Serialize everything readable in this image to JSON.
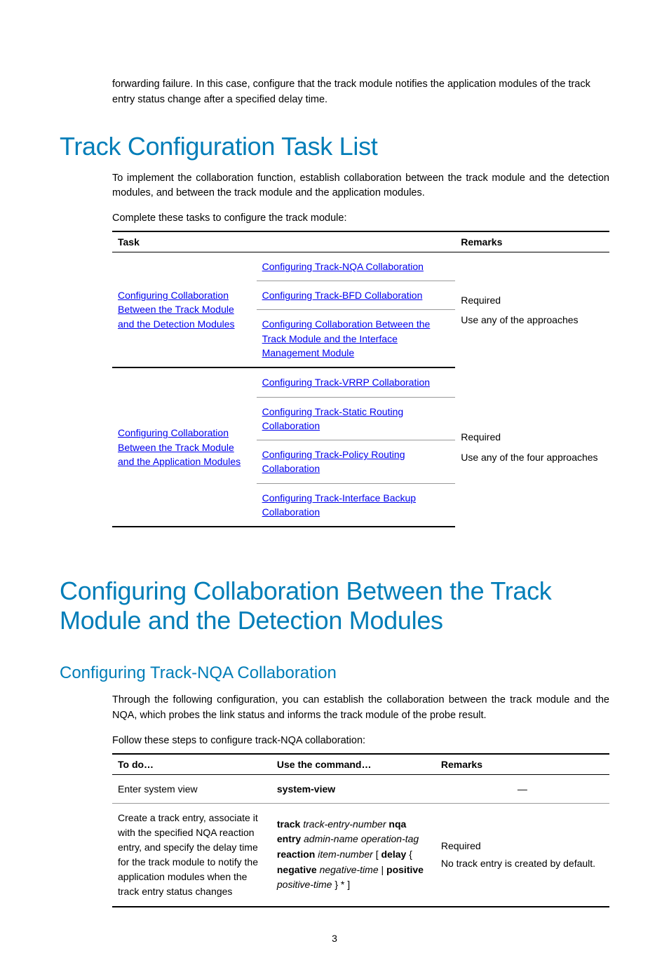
{
  "intro_paragraph": "forwarding failure. In this case, configure that the track module notifies the application modules of the track entry status change after a specified delay time.",
  "h1_1": "Track Configuration Task List",
  "p1": "To implement the collaboration function, establish collaboration between the track module and the detection modules, and between the track module and the application modules.",
  "p2": "Complete these tasks to configure the track module:",
  "table1": {
    "headers": {
      "c1": "Task",
      "c2": "",
      "c3": "Remarks"
    },
    "group1": {
      "left": "Configuring Collaboration Between the Track Module and the Detection Modules",
      "links": {
        "r1": "Configuring Track-NQA Collaboration",
        "r2": "Configuring Track-BFD Collaboration",
        "r3": "Configuring Collaboration Between the Track Module and the Interface Management Module"
      },
      "remarks_l1": "Required",
      "remarks_l2": "Use any of the approaches"
    },
    "group2": {
      "left": "Configuring Collaboration Between the Track Module and the Application Modules",
      "links": {
        "r1": "Configuring Track-VRRP Collaboration",
        "r2": "Configuring Track-Static Routing Collaboration",
        "r3": "Configuring Track-Policy Routing Collaboration",
        "r4": "Configuring Track-Interface Backup Collaboration"
      },
      "remarks_l1": "Required",
      "remarks_l2": "Use any of the four approaches"
    }
  },
  "h1_2": "Configuring Collaboration Between the Track Module and the Detection Modules",
  "h2_1": "Configuring Track-NQA Collaboration",
  "p3": "Through the following configuration, you can establish the collaboration between the track module and the NQA, which probes the link status and informs the track module of the probe result.",
  "p4": "Follow these steps to configure track-NQA collaboration:",
  "table2": {
    "headers": {
      "c1": "To do…",
      "c2": "Use the command…",
      "c3": "Remarks"
    },
    "row1": {
      "todo": "Enter system view",
      "cmd": "system-view",
      "remarks": "—"
    },
    "row2": {
      "todo": "Create a track entry, associate it with the specified NQA reaction entry, and specify the delay time for the track module to notify the application modules when the track entry status changes",
      "cmd_parts": {
        "t1": "track",
        "i1": "track-entry-number",
        "t2": "nqa entry",
        "i2": "admin-name operation-tag",
        "t3": "reaction",
        "i3": "item-number",
        "t4": "[",
        "t5": "delay",
        "t6": "{",
        "t7": "negative",
        "i4": "negative-time",
        "t8": "|",
        "t9": "positive",
        "i5": "positive-time",
        "t10": "} * ]"
      },
      "remarks_l1": "Required",
      "remarks_l2": "No track entry is created by default."
    }
  },
  "page_number": "3"
}
